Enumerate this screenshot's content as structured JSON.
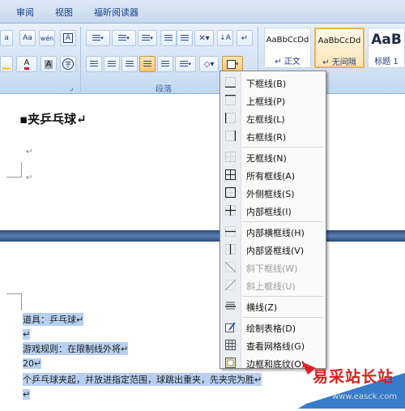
{
  "tabs": [
    "审阅",
    "视图",
    "福昕阅读器"
  ],
  "ribbon": {
    "group_paragraph": "段落",
    "styles": [
      {
        "sample": "AaBbCcDd",
        "name": "↵ 正文"
      },
      {
        "sample": "AaBbCcDd",
        "name": "↵ 无间隔"
      },
      {
        "sample": "AaB",
        "name": "标题 1"
      }
    ],
    "buttons": {
      "sort": "↓A",
      "pilcrow": "↵",
      "font_color": "A",
      "char_shading": "A",
      "enclose": "字"
    }
  },
  "document": {
    "heading": "▪夹乒乓球↵",
    "para_mark": "↵",
    "lines": [
      "道具：乒乓球↵",
      "↵",
      "游戏规则：在限制线外将↵",
      "20↵",
      "个乒乓球夹起，并放进指定范围，球跳出重夹，先夹完为胜↵",
      "↵"
    ]
  },
  "menu": {
    "items": [
      {
        "label": "下框线(B)",
        "icon": "border-bottom-icon",
        "disabled": false
      },
      {
        "label": "上框线(P)",
        "icon": "border-top-icon",
        "disabled": false
      },
      {
        "label": "左框线(L)",
        "icon": "border-left-icon",
        "disabled": false
      },
      {
        "label": "右框线(R)",
        "icon": "border-right-icon",
        "disabled": false
      },
      {
        "label": "无框线(N)",
        "icon": "no-border-icon",
        "disabled": false
      },
      {
        "label": "所有框线(A)",
        "icon": "all-borders-icon",
        "disabled": false
      },
      {
        "label": "外侧框线(S)",
        "icon": "outside-borders-icon",
        "disabled": false
      },
      {
        "label": "内部框线(I)",
        "icon": "inside-borders-icon",
        "disabled": false
      },
      {
        "label": "内部横框线(H)",
        "icon": "inside-horizontal-border-icon",
        "disabled": false
      },
      {
        "label": "内部竖框线(V)",
        "icon": "inside-vertical-border-icon",
        "disabled": false
      },
      {
        "label": "斜下框线(W)",
        "icon": "diagonal-down-border-icon",
        "disabled": true
      },
      {
        "label": "斜上框线(U)",
        "icon": "diagonal-up-border-icon",
        "disabled": true
      },
      {
        "label": "横线(Z)",
        "icon": "horizontal-line-icon",
        "disabled": false
      },
      {
        "label": "绘制表格(D)",
        "icon": "draw-table-icon",
        "disabled": false
      },
      {
        "label": "查看网格线(G)",
        "icon": "view-gridlines-icon",
        "disabled": false
      },
      {
        "label": "边框和底纹(O)...",
        "icon": "borders-shading-icon",
        "disabled": false
      }
    ]
  },
  "watermark": {
    "text": "易采站长站",
    "url": "www.easck.com"
  },
  "colors": {
    "accent": "#15428b",
    "selection": "#b8d0f0",
    "font_color": "#d42020",
    "highlight": "#f4d03f"
  }
}
